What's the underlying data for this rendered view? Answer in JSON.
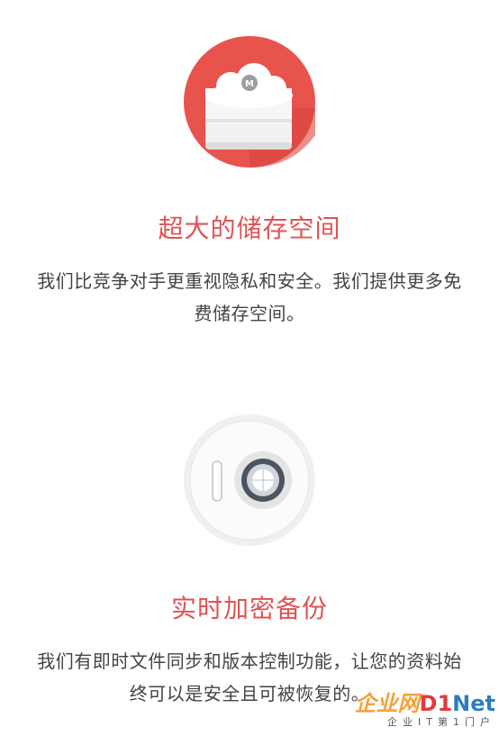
{
  "features": [
    {
      "icon": "cloud-storage-icon",
      "title": "超大的储存空间",
      "description": "我们比竞争对手更重视隐私和安全。我们提供更多免费储存空间。"
    },
    {
      "icon": "safe-vault-icon",
      "title": "实时加密备份",
      "description": "我们有即时文件同步和版本控制功能，让您的资料始终可以是安全且可被恢复的。"
    }
  ],
  "watermark": {
    "brand_cn": "企业网",
    "brand_d": "D1",
    "brand_net": "Net",
    "tagline": "企业IT第1门户"
  },
  "colors": {
    "accent": "#e05353",
    "text": "#444444",
    "icon_red": "#e8534c"
  }
}
